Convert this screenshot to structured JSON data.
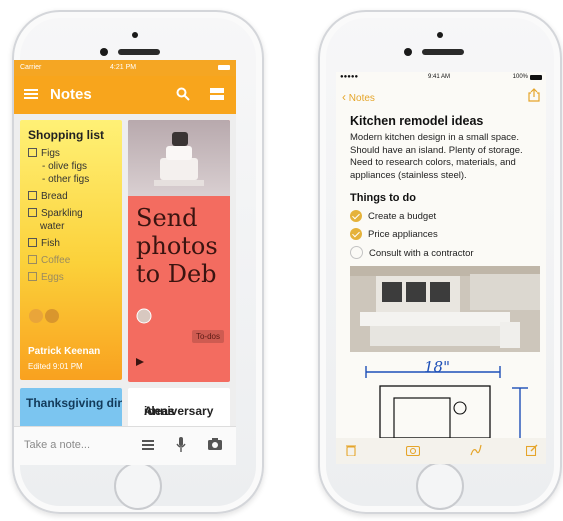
{
  "keep": {
    "status": {
      "carrier": "Carrier",
      "time": "4:21 PM"
    },
    "appbar": {
      "title": "Notes"
    },
    "shopping": {
      "title": "Shopping list",
      "items": [
        {
          "label": "Figs",
          "checked": false,
          "sub": false
        },
        {
          "label": "- olive figs",
          "checked": false,
          "sub": true
        },
        {
          "label": "- other figs",
          "checked": false,
          "sub": true
        },
        {
          "label": "Bread",
          "checked": false,
          "sub": false
        },
        {
          "label": "Sparkling",
          "checked": false,
          "sub": false
        },
        {
          "label": "water",
          "checked": false,
          "sub": true
        },
        {
          "label": "Fish",
          "checked": false,
          "sub": false
        },
        {
          "label": "Coffee",
          "checked": true,
          "sub": false
        },
        {
          "label": "Eggs",
          "checked": true,
          "sub": false
        }
      ],
      "owner": "Patrick Keenan",
      "edited": "Edited 9:01 PM"
    },
    "send": {
      "text_line1": "Send",
      "text_line2": "photos",
      "text_line3": "to Deb",
      "label": "To-dos"
    },
    "thanksgiving": {
      "title": "Thanksgiving dinner RSVPs"
    },
    "anniversary": {
      "title_line1": "Anniversary",
      "title_line2": "ideas"
    },
    "bottom": {
      "placeholder": "Take a note..."
    },
    "colors": {
      "accent": "#f8a51c",
      "shopping_card": "#fbd13a",
      "send_card": "#f36c60",
      "thanks_card": "#7bc5f0"
    }
  },
  "notes": {
    "status": {
      "carrier": "●●●●● ",
      "time": "9:41 AM",
      "battery": "100%"
    },
    "back_label": "Notes",
    "title": "Kitchen remodel ideas",
    "body": "Modern kitchen design in a small space. Should have an island. Plenty of storage. Need to research colors, materials, and appliances (stainless steel).",
    "subheading": "Things to do",
    "tasks": [
      {
        "label": "Create a budget",
        "done": true
      },
      {
        "label": "Price appliances",
        "done": true
      },
      {
        "label": "Consult with a contractor",
        "done": false
      }
    ],
    "sketch_label": "18\"",
    "colors": {
      "accent": "#e5a52a"
    }
  }
}
